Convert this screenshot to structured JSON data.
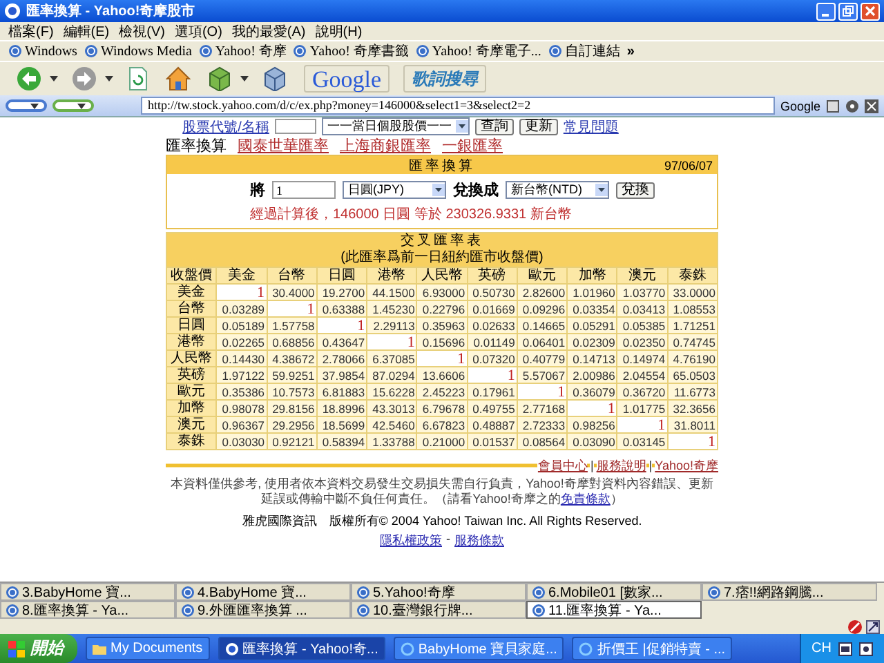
{
  "window": {
    "title": "匯率換算 - Yahoo!奇摩股市"
  },
  "menu": [
    "檔案(F)",
    "編輯(E)",
    "檢視(V)",
    "選項(O)",
    "我的最愛(A)",
    "說明(H)"
  ],
  "links": [
    "Windows",
    "Windows Media",
    "Yahoo! 奇摩",
    "Yahoo! 奇摩書籤",
    "Yahoo! 奇摩電子...",
    "自訂連結",
    "»"
  ],
  "toolbar": {
    "google_label": "Google",
    "lyrics_label": "歌詞搜尋"
  },
  "address": {
    "url": "http://tw.stock.yahoo.com/d/c/ex.php?money=146000&select1=3&select2=2",
    "search_label": "Google"
  },
  "search_row": {
    "label": "股票代號/名稱",
    "select": "一一當日個股股價一一",
    "buttons": [
      "查詢",
      "更新"
    ],
    "link": "常見問題"
  },
  "nav": [
    {
      "label": "匯率換算",
      "selected": true
    },
    {
      "label": "國泰世華匯率",
      "selected": false
    },
    {
      "label": "上海商銀匯率",
      "selected": false
    },
    {
      "label": "一銀匯率",
      "selected": false
    }
  ],
  "converter": {
    "title": "匯率換算",
    "date": "97/06/07",
    "amount_label": "將",
    "amount": "1",
    "from": "日圓(JPY)",
    "to_label": "兌換成",
    "to": "新台幣(NTD)",
    "button": "兌換",
    "result": "經過計算後，146000 日圓 等於 230326.9331 新台幣"
  },
  "cross_table": {
    "title": "交叉匯率表",
    "subtitle": "(此匯率爲前一日紐約匯市收盤價)",
    "corner": "收盤價",
    "columns": [
      "美金",
      "台幣",
      "日圓",
      "港幣",
      "人民幣",
      "英磅",
      "歐元",
      "加幣",
      "澳元",
      "泰銖"
    ],
    "rows": [
      {
        "label": "美金",
        "cells": [
          "1",
          "30.4000",
          "19.2700",
          "44.1500",
          "6.93000",
          "0.50730",
          "2.82600",
          "1.01960",
          "1.03770",
          "33.0000"
        ]
      },
      {
        "label": "台幣",
        "cells": [
          "0.03289",
          "1",
          "0.63388",
          "1.45230",
          "0.22796",
          "0.01669",
          "0.09296",
          "0.03354",
          "0.03413",
          "1.08553"
        ]
      },
      {
        "label": "日圓",
        "cells": [
          "0.05189",
          "1.57758",
          "1",
          "2.29113",
          "0.35963",
          "0.02633",
          "0.14665",
          "0.05291",
          "0.05385",
          "1.71251"
        ]
      },
      {
        "label": "港幣",
        "cells": [
          "0.02265",
          "0.68856",
          "0.43647",
          "1",
          "0.15696",
          "0.01149",
          "0.06401",
          "0.02309",
          "0.02350",
          "0.74745"
        ]
      },
      {
        "label": "人民幣",
        "cells": [
          "0.14430",
          "4.38672",
          "2.78066",
          "6.37085",
          "1",
          "0.07320",
          "0.40779",
          "0.14713",
          "0.14974",
          "4.76190"
        ]
      },
      {
        "label": "英磅",
        "cells": [
          "1.97122",
          "59.9251",
          "37.9854",
          "87.0294",
          "13.6606",
          "1",
          "5.57067",
          "2.00986",
          "2.04554",
          "65.0503"
        ]
      },
      {
        "label": "歐元",
        "cells": [
          "0.35386",
          "10.7573",
          "6.81883",
          "15.6228",
          "2.45223",
          "0.17961",
          "1",
          "0.36079",
          "0.36720",
          "11.6773"
        ]
      },
      {
        "label": "加幣",
        "cells": [
          "0.98078",
          "29.8156",
          "18.8996",
          "43.3013",
          "6.79678",
          "0.49755",
          "2.77168",
          "1",
          "1.01775",
          "32.3656"
        ]
      },
      {
        "label": "澳元",
        "cells": [
          "0.96367",
          "29.2956",
          "18.5699",
          "42.5460",
          "6.67823",
          "0.48887",
          "2.72333",
          "0.98256",
          "1",
          "31.8011"
        ]
      },
      {
        "label": "泰銖",
        "cells": [
          "0.03030",
          "0.92121",
          "0.58394",
          "1.33788",
          "0.21000",
          "0.01537",
          "0.08564",
          "0.03090",
          "0.03145",
          "1"
        ]
      }
    ]
  },
  "footer_links": {
    "items": [
      "會員中心",
      "服務說明",
      "Yahoo!奇摩"
    ],
    "separator": "|"
  },
  "disclaimer": {
    "text": "本資料僅供參考, 使用者依本資料交易發生交易損失需自行負責，Yahoo!奇摩對資料內容錯誤、更新延誤或傳輸中斷不負任何責任。（請看Yahoo!奇摩之的",
    "link": "免責條款",
    "after": "）"
  },
  "copyright": "雅虎國際資訊　版權所有© 2004 Yahoo! Taiwan Inc. All Rights Reserved.",
  "bottom_links": {
    "items": [
      "隱私權政策",
      "服務條款"
    ],
    "separator": "-"
  },
  "tabs": [
    {
      "label": "3.BabyHome 寶...",
      "selected": false
    },
    {
      "label": "4.BabyHome 寶...",
      "selected": false
    },
    {
      "label": "5.Yahoo!奇摩",
      "selected": false
    },
    {
      "label": "6.Mobile01 [數家...",
      "selected": false
    },
    {
      "label": "7.痞!!網路鋼騰...",
      "selected": false
    },
    {
      "label": "8.匯率換算 - Ya...",
      "selected": false
    },
    {
      "label": "9.外匯匯率換算 ...",
      "selected": false
    },
    {
      "label": "10.臺灣銀行牌...",
      "selected": false
    },
    {
      "label": "11.匯率換算 - Ya...",
      "selected": true
    }
  ],
  "taskbar": {
    "start": "開始",
    "tasks": [
      {
        "label": "My Documents",
        "kind": "folder",
        "selected": false
      },
      {
        "label": "匯率換算 - Yahoo!奇...",
        "kind": "browser",
        "selected": true
      },
      {
        "label": "BabyHome 寶貝家庭...",
        "kind": "ie",
        "selected": false
      },
      {
        "label": "折價王 |促銷特賣 - ...",
        "kind": "ie",
        "selected": false
      }
    ],
    "language": "CH"
  }
}
